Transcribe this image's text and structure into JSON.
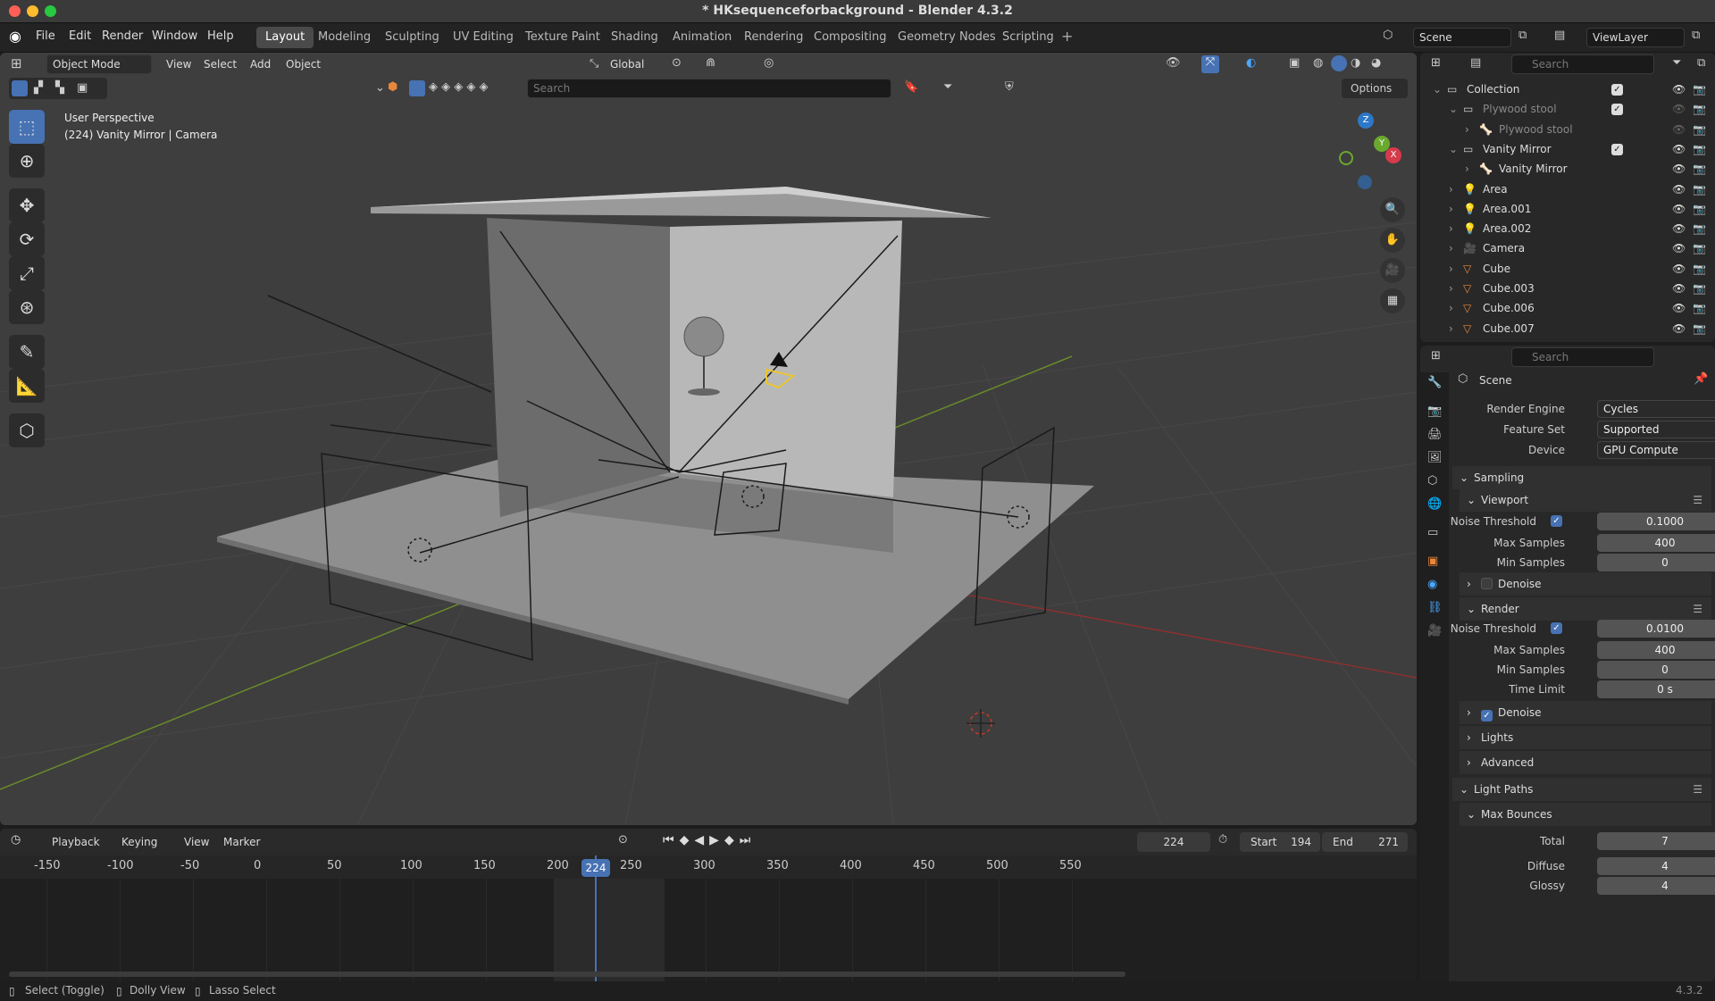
{
  "window": {
    "title": "* HKsequenceforbackground - Blender 4.3.2"
  },
  "menu": [
    "File",
    "Edit",
    "Render",
    "Window",
    "Help"
  ],
  "workspaces": [
    "Layout",
    "Modeling",
    "Sculpting",
    "UV Editing",
    "Texture Paint",
    "Shading",
    "Animation",
    "Rendering",
    "Compositing",
    "Geometry Nodes",
    "Scripting"
  ],
  "active_workspace": "Layout",
  "scene": {
    "label": "Scene",
    "viewlayer": "ViewLayer"
  },
  "viewport": {
    "mode": "Object Mode",
    "menus": [
      "View",
      "Select",
      "Add",
      "Object"
    ],
    "transform": "Global",
    "search_placeholder": "Search",
    "options": "Options",
    "overlay_line1": "User Perspective",
    "overlay_line2": "(224) Vanity Mirror | Camera",
    "gizmo_axes": [
      "Z",
      "Y",
      "X"
    ]
  },
  "tools": [
    "select-box",
    "cursor",
    "move",
    "rotate",
    "scale",
    "transform",
    "annotate",
    "measure",
    "add-cube"
  ],
  "outliner": {
    "search_placeholder": "Search",
    "rows": [
      {
        "label": "Collection",
        "indent": 0,
        "type": "collection",
        "dim": false
      },
      {
        "label": "Plywood stool",
        "indent": 1,
        "type": "collection",
        "dim": true
      },
      {
        "label": "Plywood stool",
        "indent": 2,
        "type": "armature",
        "dim": true
      },
      {
        "label": "Vanity Mirror",
        "indent": 1,
        "type": "collection",
        "dim": false
      },
      {
        "label": "Vanity Mirror",
        "indent": 2,
        "type": "armature",
        "dim": false
      },
      {
        "label": "Area",
        "indent": 1,
        "type": "light",
        "dim": false
      },
      {
        "label": "Area.001",
        "indent": 1,
        "type": "light",
        "dim": false
      },
      {
        "label": "Area.002",
        "indent": 1,
        "type": "light",
        "dim": false
      },
      {
        "label": "Camera",
        "indent": 1,
        "type": "camera",
        "dim": false
      },
      {
        "label": "Cube",
        "indent": 1,
        "type": "mesh",
        "dim": false
      },
      {
        "label": "Cube.003",
        "indent": 1,
        "type": "mesh",
        "dim": false
      },
      {
        "label": "Cube.006",
        "indent": 1,
        "type": "mesh",
        "dim": false
      },
      {
        "label": "Cube.007",
        "indent": 1,
        "type": "mesh",
        "dim": false
      }
    ]
  },
  "properties": {
    "search_placeholder": "Search",
    "context": "Scene",
    "render_engine": {
      "label": "Render Engine",
      "value": "Cycles"
    },
    "feature_set": {
      "label": "Feature Set",
      "value": "Supported"
    },
    "device": {
      "label": "Device",
      "value": "GPU Compute"
    },
    "sampling": "Sampling",
    "viewport_panel": "Viewport",
    "vp_noise": {
      "label": "Noise Threshold",
      "value": "0.1000"
    },
    "vp_max": {
      "label": "Max Samples",
      "value": "400"
    },
    "vp_min": {
      "label": "Min Samples",
      "value": "0"
    },
    "vp_denoise": "Denoise",
    "render_panel": "Render",
    "r_noise": {
      "label": "Noise Threshold",
      "value": "0.0100"
    },
    "r_max": {
      "label": "Max Samples",
      "value": "400"
    },
    "r_min": {
      "label": "Min Samples",
      "value": "0"
    },
    "r_time": {
      "label": "Time Limit",
      "value": "0 s"
    },
    "r_denoise": "Denoise",
    "lights": "Lights",
    "advanced": "Advanced",
    "light_paths": "Light Paths",
    "max_bounces": "Max Bounces",
    "total": {
      "label": "Total",
      "value": "7"
    },
    "diffuse": {
      "label": "Diffuse",
      "value": "4"
    },
    "glossy": {
      "label": "Glossy",
      "value": "4"
    }
  },
  "timeline": {
    "menus": [
      "Playback",
      "Keying",
      "View",
      "Marker"
    ],
    "current_frame": "224",
    "start_label": "Start",
    "start": "194",
    "end_label": "End",
    "end": "271",
    "ticks": [
      "-150",
      "-100",
      "-50",
      "0",
      "50",
      "100",
      "150",
      "200",
      "250",
      "300",
      "350",
      "400",
      "450",
      "500",
      "550"
    ],
    "playhead": "224"
  },
  "status": {
    "items": [
      "Select (Toggle)",
      "Dolly View",
      "Lasso Select"
    ],
    "version": "4.3.2"
  }
}
